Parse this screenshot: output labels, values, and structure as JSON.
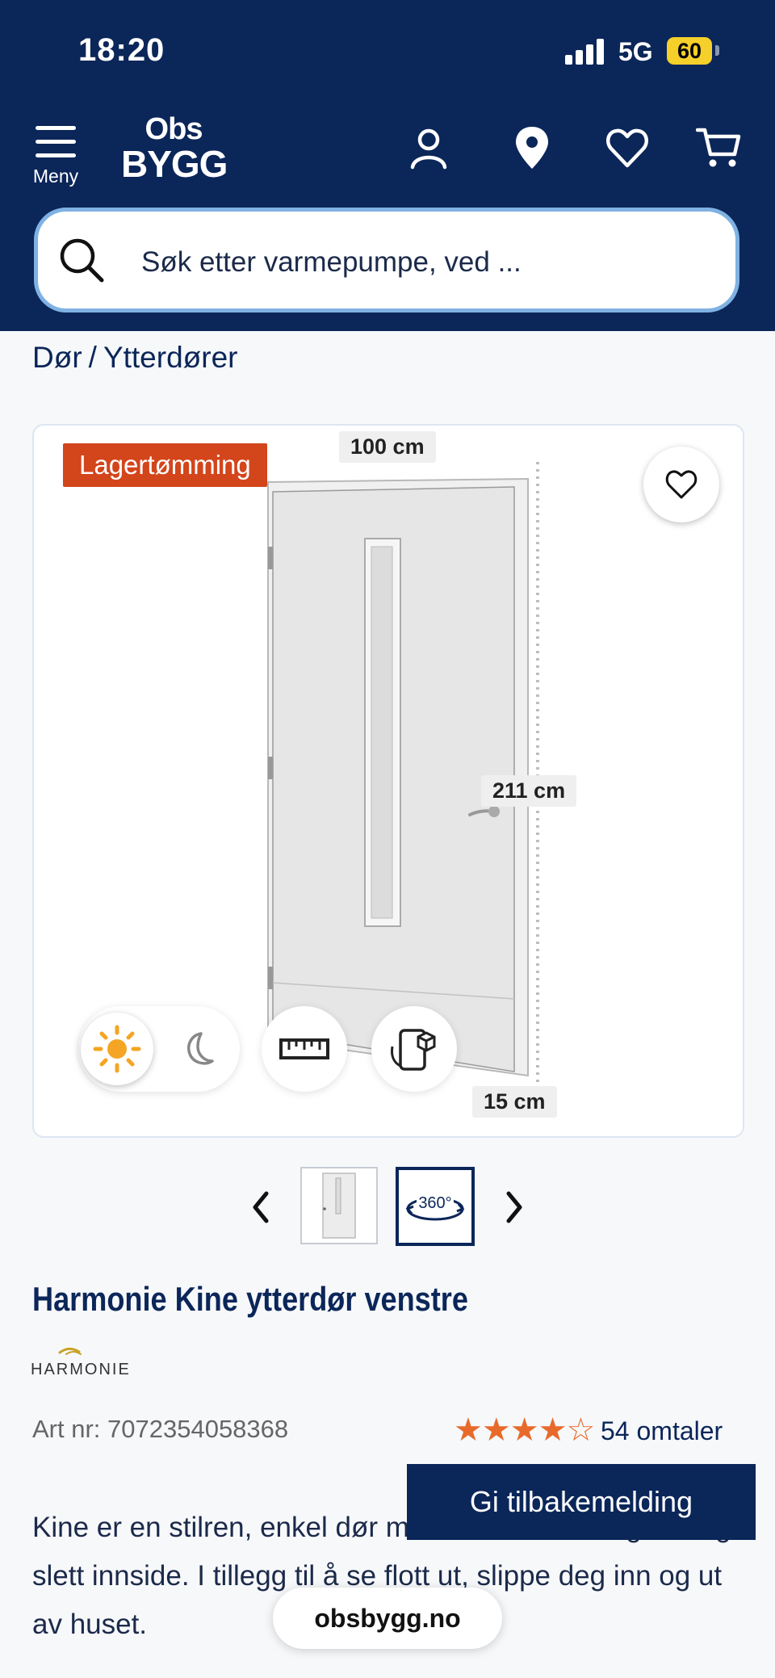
{
  "status_bar": {
    "time": "18:20",
    "network": "5G",
    "battery": "60"
  },
  "header": {
    "menu_label": "Meny",
    "logo_top": "Obs",
    "logo_bottom": "BYGG"
  },
  "search": {
    "placeholder": "Søk etter varmepumpe, ved ..."
  },
  "breadcrumb": {
    "items": [
      "Dør",
      "/",
      "Ytterdører"
    ]
  },
  "gallery": {
    "badge": "Lagertømming",
    "dim_width": "100 cm",
    "dim_height": "211 cm",
    "dim_depth": "15 cm",
    "thumb2_label": "360°"
  },
  "product": {
    "title": "Harmonie Kine ytterdør venstre",
    "brand": "HARMONIE",
    "art_nr": "Art nr: 7072354058368",
    "stars": "★★★★☆",
    "rating": 4.5,
    "reviews": "54 omtaler",
    "description": "Kine er en stilren, enkel dør med smalt sidestilt glass og slett innside. I tillegg til å se flott ut, slippe deg inn og ut av huset."
  },
  "feedback_button": "Gi tilbakemelding",
  "url_bar": "obsbygg.no",
  "colors": {
    "navy": "#0b2659",
    "badge": "#d3451b",
    "stars": "#e86a2b",
    "search_border": "#7fb2e3"
  }
}
